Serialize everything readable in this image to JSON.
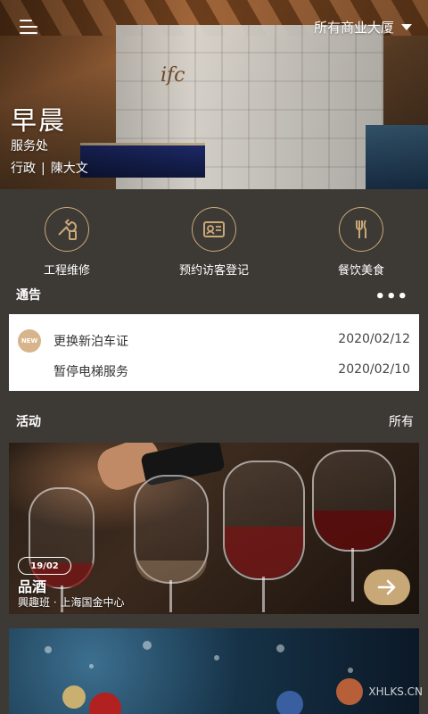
{
  "header": {
    "building_selector": "所有商业大厦",
    "logo_text": "ifc",
    "greeting": "早晨",
    "department": "服务处",
    "role": "行政",
    "separator": "|",
    "user_name": "陳大文"
  },
  "services": [
    {
      "label": "工程维修",
      "icon": "wrench-icon"
    },
    {
      "label": "预约访客登记",
      "icon": "visitor-card-icon"
    },
    {
      "label": "餐饮美食",
      "icon": "fork-knife-icon"
    }
  ],
  "notices": {
    "title": "通告",
    "more": "•••",
    "items": [
      {
        "badge": "NEW",
        "title": "更换新泊车证",
        "date": "2020/02/12"
      },
      {
        "badge": "",
        "title": "暂停电梯服务",
        "date": "2020/02/10"
      }
    ]
  },
  "activities": {
    "title": "活动",
    "all_label": "所有",
    "items": [
      {
        "date": "19/02",
        "title": "品酒",
        "subtitle": "興趣班 · 上海国金中心"
      }
    ]
  },
  "watermark": {
    "text": "XHLKS.CN"
  },
  "colors": {
    "background": "#3d3a35",
    "accent": "#c9a878",
    "card": "#ffffff"
  }
}
